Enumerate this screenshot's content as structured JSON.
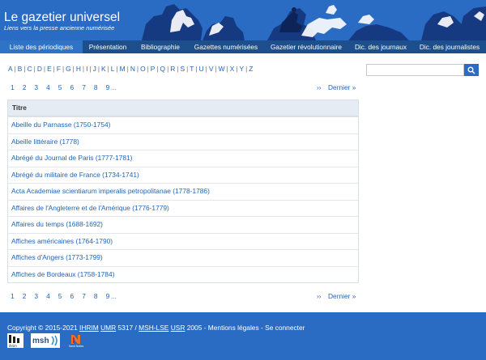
{
  "header": {
    "title": "Le gazetier universel",
    "subtitle": "Liens vers la presse ancienne numérisée"
  },
  "nav": {
    "items": [
      {
        "label": "Liste des périodiques",
        "active": true
      },
      {
        "label": "Présentation"
      },
      {
        "label": "Bibliographie"
      },
      {
        "label": "Gazettes numérisées"
      },
      {
        "label": "Gazetier révolutionnaire"
      },
      {
        "label": "Dic. des journaux"
      },
      {
        "label": "Dic. des journalistes"
      }
    ]
  },
  "alphabet": [
    "A",
    "B",
    "C",
    "D",
    "E",
    "F",
    "G",
    "H",
    "I",
    "J",
    "K",
    "L",
    "M",
    "N",
    "O",
    "P",
    "Q",
    "R",
    "S",
    "T",
    "U",
    "V",
    "W",
    "X",
    "Y",
    "Z"
  ],
  "pager": {
    "pages": [
      "1",
      "2",
      "3",
      "4",
      "5",
      "6",
      "7",
      "8",
      "9"
    ],
    "ellipsis": "...",
    "next": "››",
    "last": "Dernier »"
  },
  "search": {
    "placeholder": "",
    "icon": "search-icon"
  },
  "table": {
    "header": "Titre",
    "rows": [
      "Abeille du Parnasse (1750-1754)",
      "Abeille littéraire (1778)",
      "Abrégé du Journal de Paris (1777-1781)",
      "Abrégé du militaire de France (1734-1741)",
      "Acta Academiae scientiarum imperalis petropolitanae (1778-1786)",
      "Affaires de l'Angleterre et de l'Amérique (1776-1779)",
      "Affaires du temps (1688-1692)",
      "Affiches américaines (1764-1790)",
      "Affiches d'Angers (1773-1799)",
      "Affiches de Bordeaux (1758-1784)"
    ]
  },
  "footer": {
    "copy_prefix": "Copyright © 2015-2021 ",
    "ihrim": "IHRIM",
    "umr": "UMR",
    "mid1": " 5317 / ",
    "mshlse": "MSH-LSE",
    "usr": "USR",
    "mid2": " 2005 - ",
    "legal": "Mentions légales",
    "dash": " - ",
    "login": "Se connecter",
    "logo_ihrim": "ihrim",
    "logo_msh": "msh",
    "logo_nd": "Nord Notes"
  },
  "colors": {
    "brand": "#2a6cc4",
    "nav": "#1c4f8c",
    "nav_active": "#2e73c6",
    "link": "#1f63b8"
  }
}
